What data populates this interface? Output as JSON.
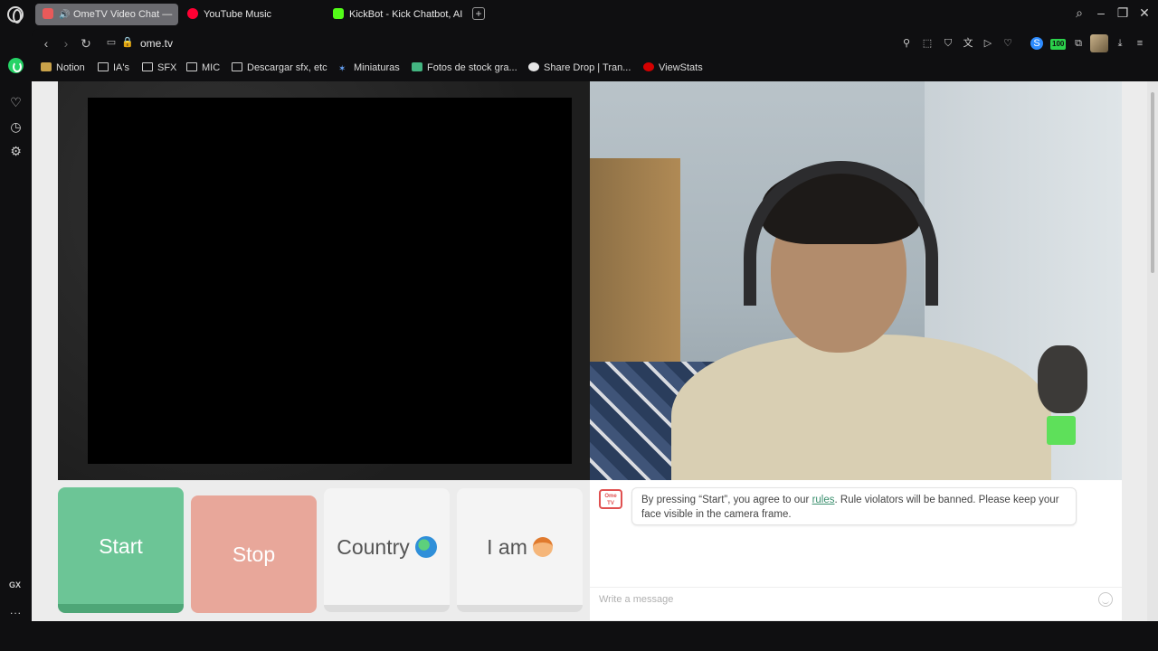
{
  "browser": {
    "tabs": [
      {
        "label": "OmeTV Video Chat —",
        "active": true,
        "favicon_color": "#e85a5a",
        "audio": true
      },
      {
        "label": "YouTube Music",
        "active": false,
        "favicon_color": "#ff0033"
      },
      {
        "label": "KickBot - Kick Chatbot, AI",
        "active": false,
        "favicon_color": "#53fc18"
      }
    ],
    "new_tab_label": "+",
    "url": "ome.tv",
    "extension_badge": "100",
    "bookmarks": [
      {
        "label": "Notion",
        "icon": "notion-icon"
      },
      {
        "label": "IA's",
        "icon": "folder-icon"
      },
      {
        "label": "SFX",
        "icon": "folder-icon"
      },
      {
        "label": "MIC",
        "icon": "folder-icon"
      },
      {
        "label": "Descargar sfx, etc",
        "icon": "folder-icon"
      },
      {
        "label": "Miniaturas",
        "icon": "star-icon"
      },
      {
        "label": "Fotos de stock gra...",
        "icon": "stock-icon"
      },
      {
        "label": "Share Drop | Tran...",
        "icon": "sharedrop-icon"
      },
      {
        "label": "ViewStats",
        "icon": "viewstats-icon"
      }
    ],
    "sidebar_gx": "GX",
    "sidebar_more": "..."
  },
  "ometv": {
    "buttons": {
      "start": "Start",
      "stop": "Stop",
      "country": "Country",
      "iam": "I am"
    },
    "chat": {
      "logo": "Ome TV",
      "message_before": "By pressing “Start”, you agree to our ",
      "rules_link": "rules",
      "message_after": ". Rule violators will be banned. Please keep your face visible in the camera frame.",
      "input_placeholder": "Write a message"
    }
  },
  "colors": {
    "start": "#6cc596",
    "stop": "#e8a79a",
    "rules_link": "#3a8f6e"
  }
}
